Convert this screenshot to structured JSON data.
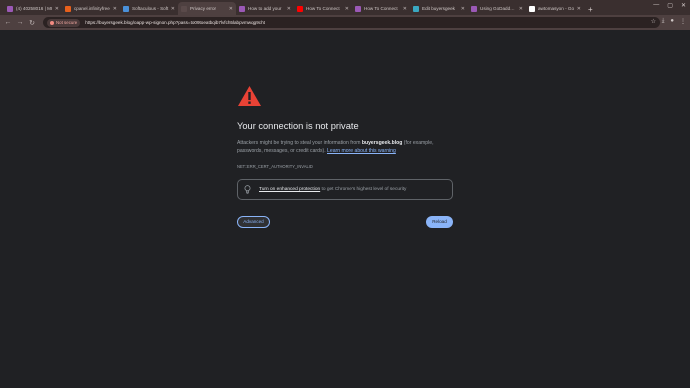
{
  "tabs": [
    {
      "label": "(4) 40258016 | MI",
      "color": "#9b59b6",
      "active": false
    },
    {
      "label": "cpanel.infinityfree",
      "color": "#e8601c",
      "active": false
    },
    {
      "label": "Softaculous - Soft",
      "color": "#4a90d9",
      "active": false
    },
    {
      "label": "Privacy error",
      "color": "#5a4a4a",
      "active": true
    },
    {
      "label": "How to add your",
      "color": "#9b59b6",
      "active": false
    },
    {
      "label": "How To Connect",
      "color": "#ff0000",
      "active": false
    },
    {
      "label": "How To Connect",
      "color": "#9b59b6",
      "active": false
    },
    {
      "label": "Edit buyersgeek",
      "color": "#3aa8c1",
      "active": false
    },
    {
      "label": "Using GoDaddy D",
      "color": "#9b59b6",
      "active": false
    },
    {
      "label": "awtomasyon - Go",
      "color": "#ffffff",
      "active": false
    }
  ],
  "toolbar": {
    "security_label": "Not secure",
    "url": "https://buyersgeek.blog/oapp-wp-signon.php?pass=to09toeatbqib7lvfch5labpvmwqg9cht"
  },
  "error": {
    "headline": "Your connection is not private",
    "explain_prefix": "Attackers might be trying to steal your information from ",
    "domain": "buyersgeek.blog",
    "explain_suffix": " (for example, passwords, messages, or credit cards). ",
    "learn_more": "Learn more about this warning",
    "code": "NET::ERR_CERT_AUTHORITY_INVALID",
    "enhanced_link": "Turn on enhanced protection",
    "enhanced_rest": " to get Chrome's highest level of security",
    "advanced_label": "Advanced",
    "reload_label": "Reload"
  },
  "colors": {
    "accent": "#8ab4f8",
    "warning": "#e94235",
    "background": "#202124"
  }
}
